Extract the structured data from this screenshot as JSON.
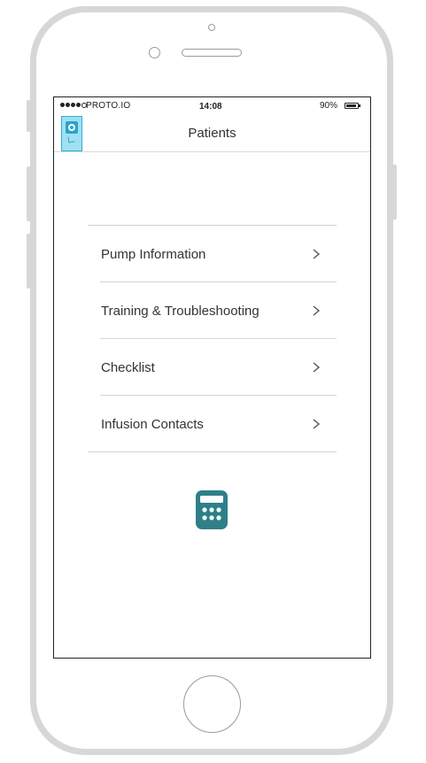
{
  "status_bar": {
    "carrier": "PROTO.IO",
    "time": "14:08",
    "battery_percent": "90%",
    "battery_level": 0.9,
    "signal_bars_filled": 4,
    "signal_bars_total": 5
  },
  "nav": {
    "title": "Patients",
    "logo_icon": "app-logo-icon"
  },
  "menu": {
    "items": [
      {
        "label": "Pump Information"
      },
      {
        "label": "Training & Troubleshooting"
      },
      {
        "label": "Checklist"
      },
      {
        "label": "Infusion Contacts"
      }
    ]
  },
  "calculator": {
    "icon": "calculator-icon"
  },
  "colors": {
    "accent": "#2e8088",
    "logo_fill": "#9fe0f2",
    "logo_border": "#2eaed3",
    "divider": "#d5d5d5",
    "text": "#333333"
  }
}
